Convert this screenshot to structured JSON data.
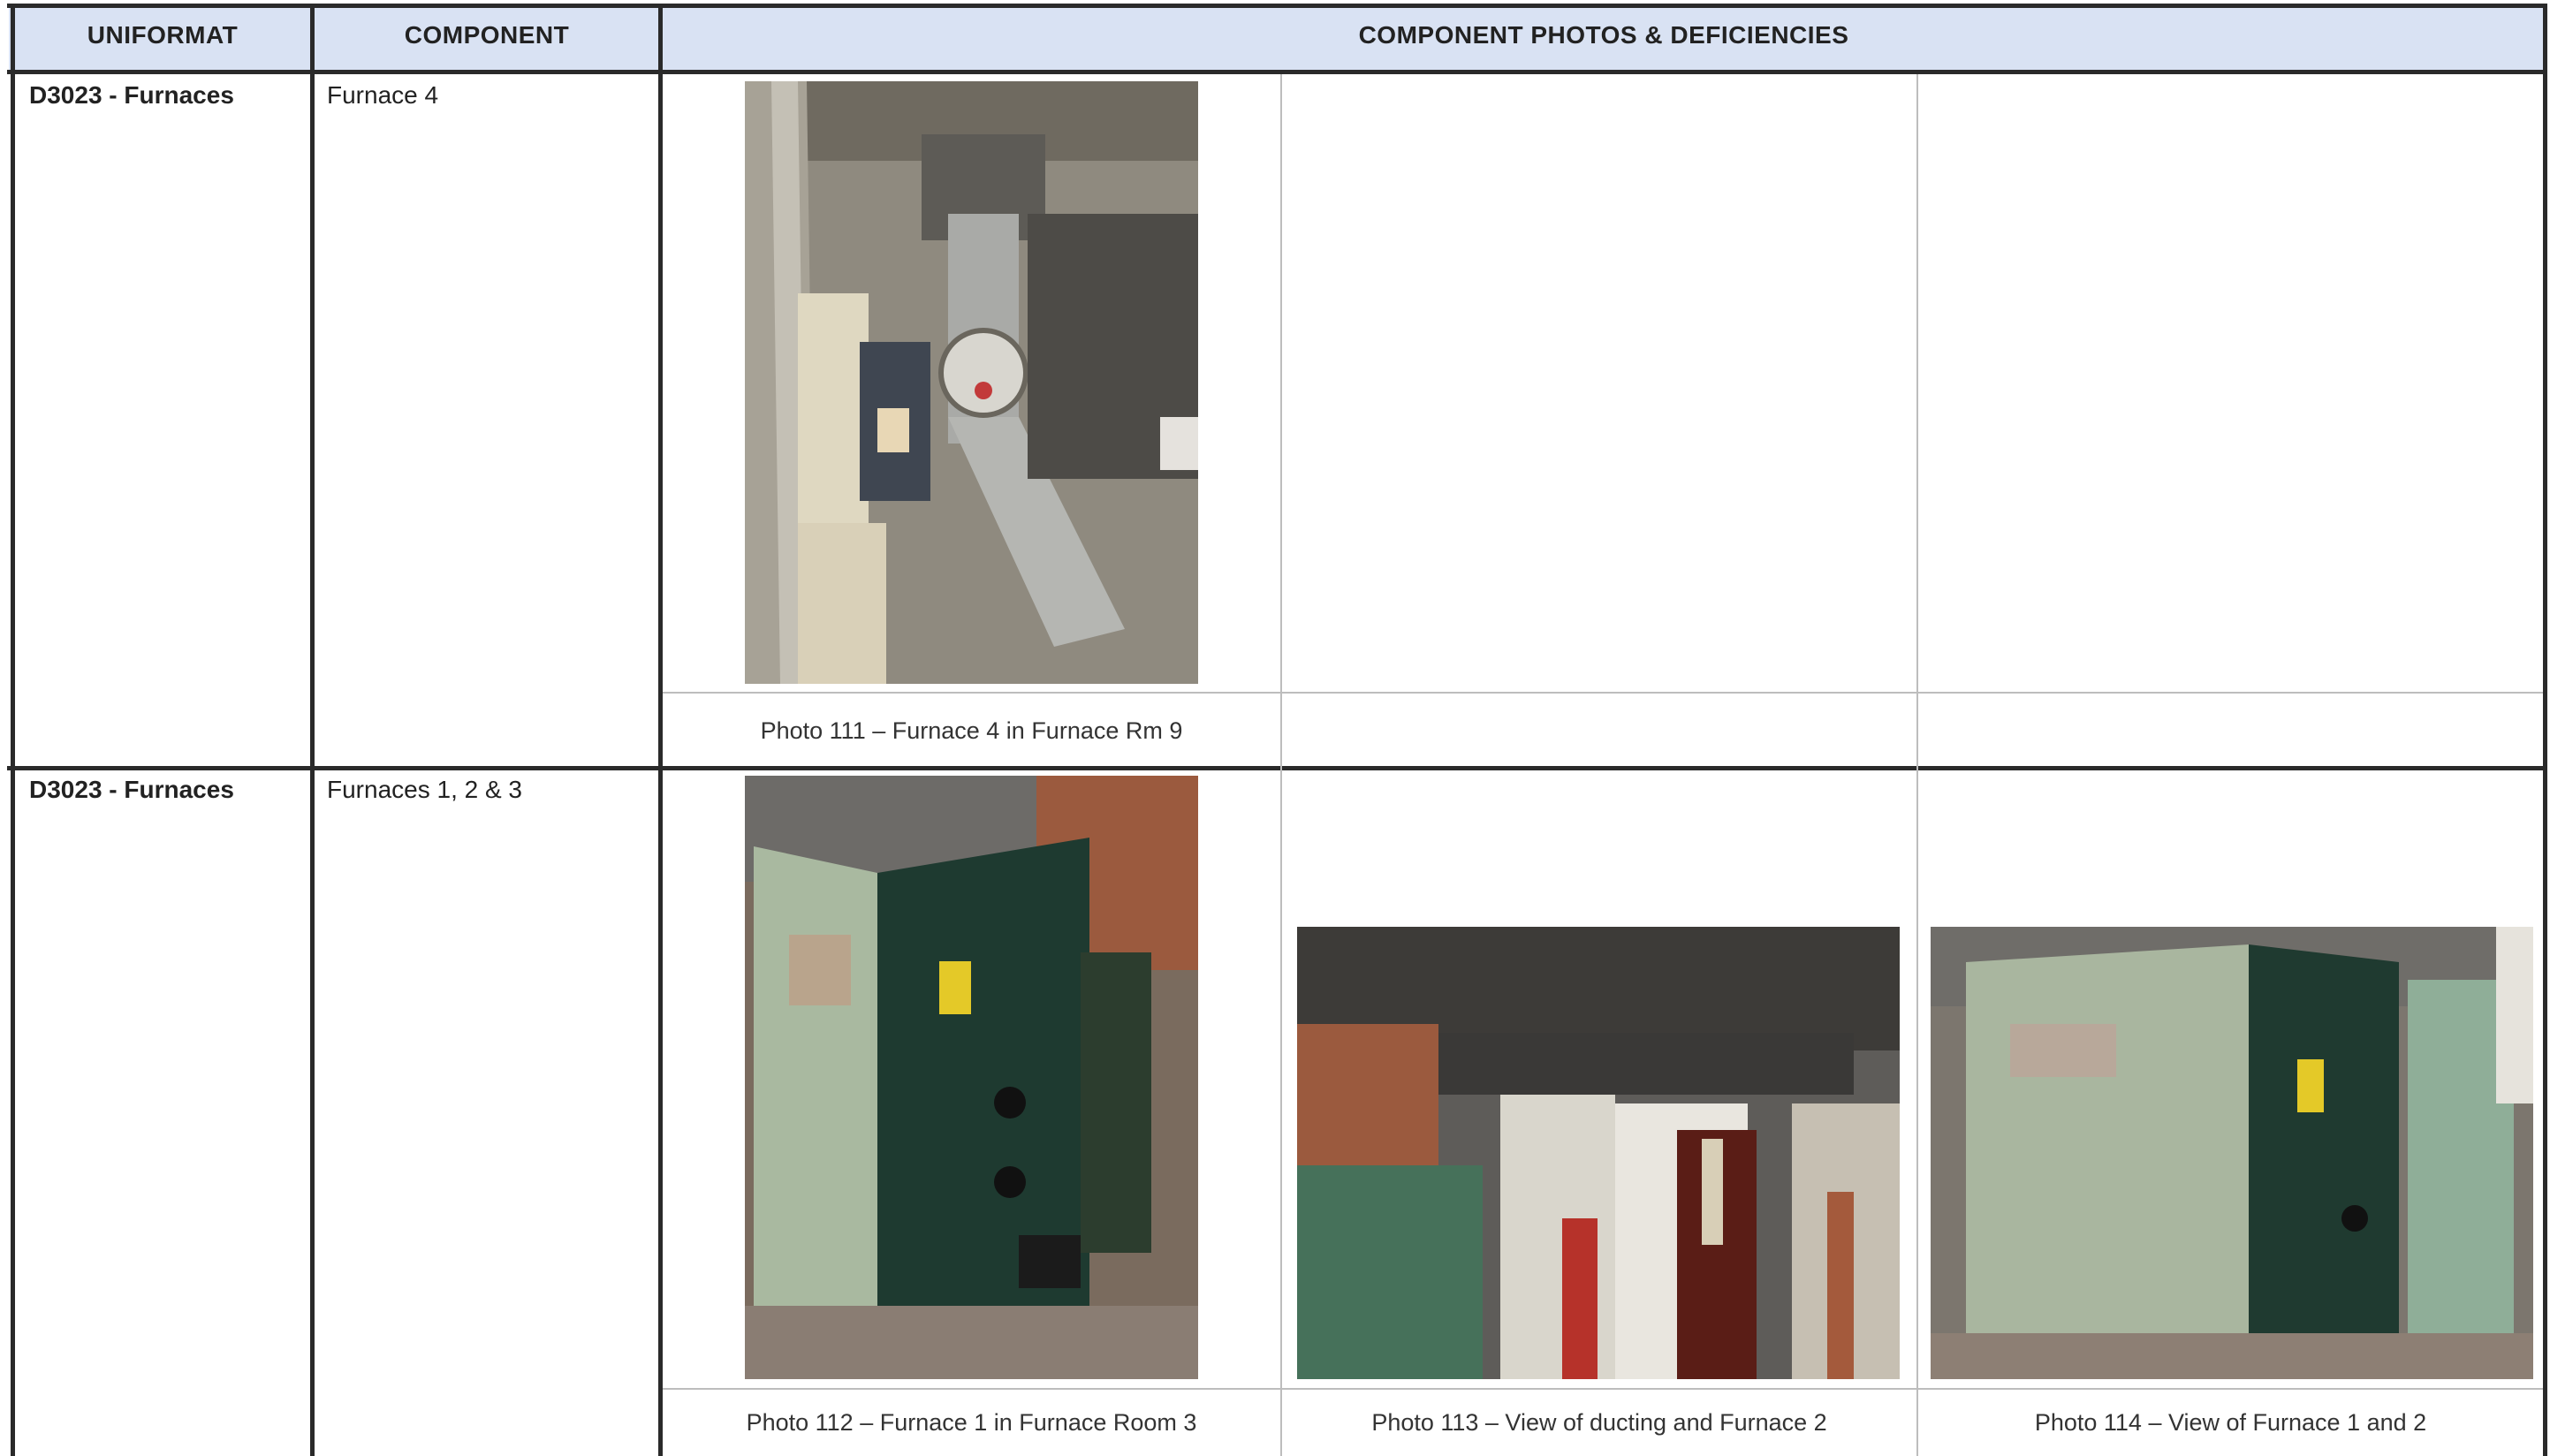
{
  "headers": {
    "uniformat": "UNIFORMAT",
    "component": "COMPONENT",
    "photos": "COMPONENT PHOTOS & DEFICIENCIES"
  },
  "rows": [
    {
      "uniformat": "D3023 - Furnaces",
      "component": "Furnace 4",
      "captions": [
        "Photo 111 – Furnace 4 in Furnace Rm 9",
        "",
        ""
      ]
    },
    {
      "uniformat": "D3023 - Furnaces",
      "component": "Furnaces 1, 2 & 3",
      "captions": [
        "Photo 112 – Furnace 1 in Furnace Room 3",
        "Photo 113 – View of ducting and Furnace 2",
        "Photo 114 – View of Furnace 1 and 2"
      ]
    }
  ],
  "photos": [
    {
      "name": "photo-111",
      "subject": "furnace flue and electrical panel"
    },
    {
      "name": "photo-112",
      "subject": "green furnace 1"
    },
    {
      "name": "photo-113",
      "subject": "ducting and furnace 2"
    },
    {
      "name": "photo-114",
      "subject": "furnace 1 and 2"
    }
  ],
  "colors": {
    "header_bg": "#d9e2f3",
    "border": "#2a2a2a",
    "inner_border": "#bdbdbd"
  }
}
